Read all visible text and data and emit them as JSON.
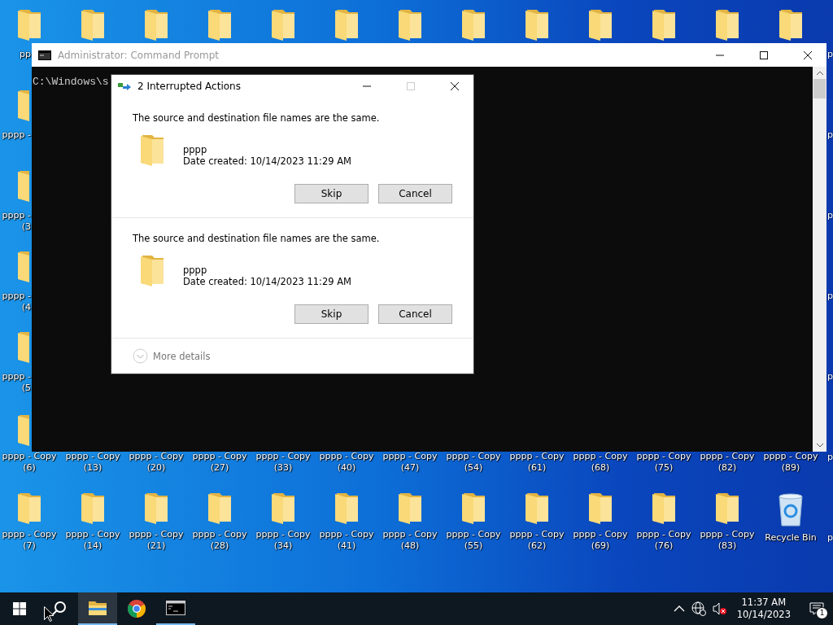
{
  "desktop": {
    "rows": [
      {
        "icons": [
          {
            "kind": "folder",
            "label": "pp"
          },
          {
            "kind": "folder"
          },
          {
            "kind": "folder"
          },
          {
            "kind": "folder"
          },
          {
            "kind": "folder"
          },
          {
            "kind": "folder"
          },
          {
            "kind": "folder"
          },
          {
            "kind": "folder"
          },
          {
            "kind": "folder"
          },
          {
            "kind": "folder"
          },
          {
            "kind": "folder"
          },
          {
            "kind": "folder"
          },
          {
            "kind": "folder"
          }
        ],
        "edge_label": "p"
      },
      {
        "icons": [
          {
            "kind": "folder",
            "label": "pppp -"
          }
        ],
        "edge_label": "p"
      },
      {
        "icons": [
          {
            "kind": "folder",
            "label": "pppp -",
            "number": "(3"
          }
        ],
        "edge_label": "p"
      },
      {
        "icons": [
          {
            "kind": "folder",
            "label": "pppp -",
            "number": "(4"
          }
        ],
        "edge_label": "p"
      },
      {
        "icons": [
          {
            "kind": "folder",
            "label": "pppp -",
            "number": "(5"
          }
        ],
        "edge_label": "p"
      },
      {
        "icons": [
          {
            "kind": "folder",
            "label": "pppp - Copy",
            "number": "(6)"
          },
          {
            "kind": "label",
            "label": "pppp - Copy",
            "number": "(13)"
          },
          {
            "kind": "label",
            "label": "pppp - Copy",
            "number": "(20)"
          },
          {
            "kind": "label",
            "label": "pppp - Copy",
            "number": "(27)"
          },
          {
            "kind": "label",
            "label": "pppp - Copy",
            "number": "(33)"
          },
          {
            "kind": "label",
            "label": "pppp - Copy",
            "number": "(40)"
          },
          {
            "kind": "label",
            "label": "pppp - Copy",
            "number": "(47)"
          },
          {
            "kind": "label",
            "label": "pppp - Copy",
            "number": "(54)"
          },
          {
            "kind": "label",
            "label": "pppp - Copy",
            "number": "(61)"
          },
          {
            "kind": "label",
            "label": "pppp - Copy",
            "number": "(68)"
          },
          {
            "kind": "label",
            "label": "pppp - Copy",
            "number": "(75)"
          },
          {
            "kind": "label",
            "label": "pppp - Copy",
            "number": "(82)"
          },
          {
            "kind": "label",
            "label": "pppp - Copy",
            "number": "(89)"
          }
        ],
        "edge_label": "p"
      },
      {
        "icons": [
          {
            "kind": "folder",
            "label": "pppp - Copy",
            "number": "(7)"
          },
          {
            "kind": "folder",
            "label": "pppp - Copy",
            "number": "(14)"
          },
          {
            "kind": "folder",
            "label": "pppp - Copy",
            "number": "(21)"
          },
          {
            "kind": "folder",
            "label": "pppp - Copy",
            "number": "(28)"
          },
          {
            "kind": "folder",
            "label": "pppp - Copy",
            "number": "(34)"
          },
          {
            "kind": "folder",
            "label": "pppp - Copy",
            "number": "(41)"
          },
          {
            "kind": "folder",
            "label": "pppp - Copy",
            "number": "(48)"
          },
          {
            "kind": "folder",
            "label": "pppp - Copy",
            "number": "(55)"
          },
          {
            "kind": "folder",
            "label": "pppp - Copy",
            "number": "(62)"
          },
          {
            "kind": "folder",
            "label": "pppp - Copy",
            "number": "(69)"
          },
          {
            "kind": "folder",
            "label": "pppp - Copy",
            "number": "(76)"
          },
          {
            "kind": "folder",
            "label": "pppp - Copy",
            "number": "(83)"
          },
          {
            "kind": "recycle_bin",
            "label": "Recycle Bin"
          }
        ],
        "edge_label": "p"
      }
    ]
  },
  "console_window": {
    "title": "Administrator: Command Prompt",
    "active": false,
    "text": "C:\\Windows\\s"
  },
  "dialog": {
    "title": "2 Interrupted Actions",
    "active": true,
    "title_controls": [
      {
        "kind": "minimize",
        "disabled": false
      },
      {
        "kind": "maximize",
        "disabled": true
      },
      {
        "kind": "close",
        "disabled": false
      }
    ],
    "conflicts": [
      {
        "message": "The source and destination file names are the same.",
        "name": "pppp",
        "date": "Date created: 10/14/2023 11:29 AM",
        "buttons": [
          "Skip",
          "Cancel"
        ]
      },
      {
        "message": "The source and destination file names are the same.",
        "name": "pppp",
        "date": "Date created: 10/14/2023 11:29 AM",
        "buttons": [
          "Skip",
          "Cancel"
        ]
      }
    ],
    "more_details": "More details"
  },
  "taskbar": {
    "items": [
      {
        "kind": "start",
        "active": false,
        "open": false
      },
      {
        "kind": "search",
        "active": false,
        "open": false
      },
      {
        "kind": "explorer",
        "active": true,
        "open": true
      },
      {
        "kind": "chrome",
        "active": false,
        "open": false
      },
      {
        "kind": "terminal",
        "active": false,
        "open": true
      }
    ],
    "time": "11:37 AM",
    "date": "10/14/2023",
    "notification_count": "1"
  }
}
